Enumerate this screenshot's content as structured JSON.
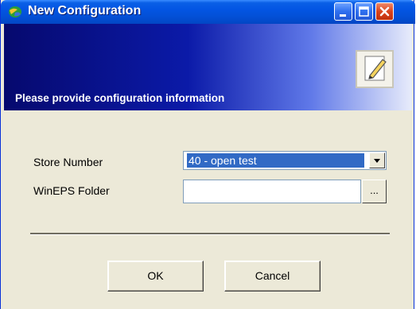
{
  "window": {
    "title": "New Configuration",
    "icon": "app-globe-icon",
    "controls": {
      "minimize": "minimize-icon",
      "maximize": "maximize-icon",
      "close": "close-icon"
    }
  },
  "banner": {
    "text": "Please provide configuration information",
    "icon": "edit-pencil-icon"
  },
  "form": {
    "store_number_label": "Store Number",
    "store_number_value": "40 - open test",
    "wineps_folder_label": "WinEPS Folder",
    "wineps_folder_value": "",
    "browse_label": "..."
  },
  "buttons": {
    "ok": "OK",
    "cancel": "Cancel"
  },
  "colors": {
    "titlebar": "#0355e3",
    "selection": "#316ac5",
    "dialog_bg": "#ece9d8"
  }
}
